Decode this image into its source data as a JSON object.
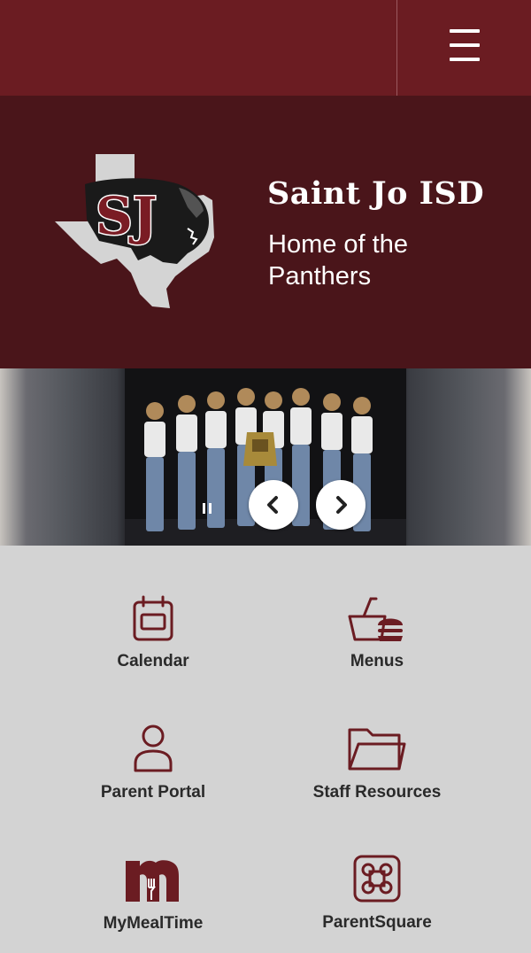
{
  "header": {
    "menu_icon": "hamburger-menu-icon"
  },
  "hero": {
    "logo_letters": "SJ",
    "title": "Saint Jo ISD",
    "subtitle": "Home of the Panthers"
  },
  "carousel": {
    "prev_icon": "chevron-left-icon",
    "next_icon": "chevron-right-icon",
    "pause_icon": "pause-icon"
  },
  "quick_links": [
    {
      "label": "Calendar",
      "icon": "calendar-icon"
    },
    {
      "label": "Menus",
      "icon": "food-tray-icon"
    },
    {
      "label": "Parent Portal",
      "icon": "person-icon"
    },
    {
      "label": "Staff Resources",
      "icon": "folder-icon"
    },
    {
      "label": "MyMealTime",
      "icon": "mymealtime-logo-icon"
    },
    {
      "label": "ParentSquare",
      "icon": "parentsquare-icon"
    }
  ],
  "colors": {
    "primary": "#6b1c22",
    "hero_bg": "#4a151a",
    "icon": "#6b1c22",
    "page_bg": "#d3d3d3"
  }
}
